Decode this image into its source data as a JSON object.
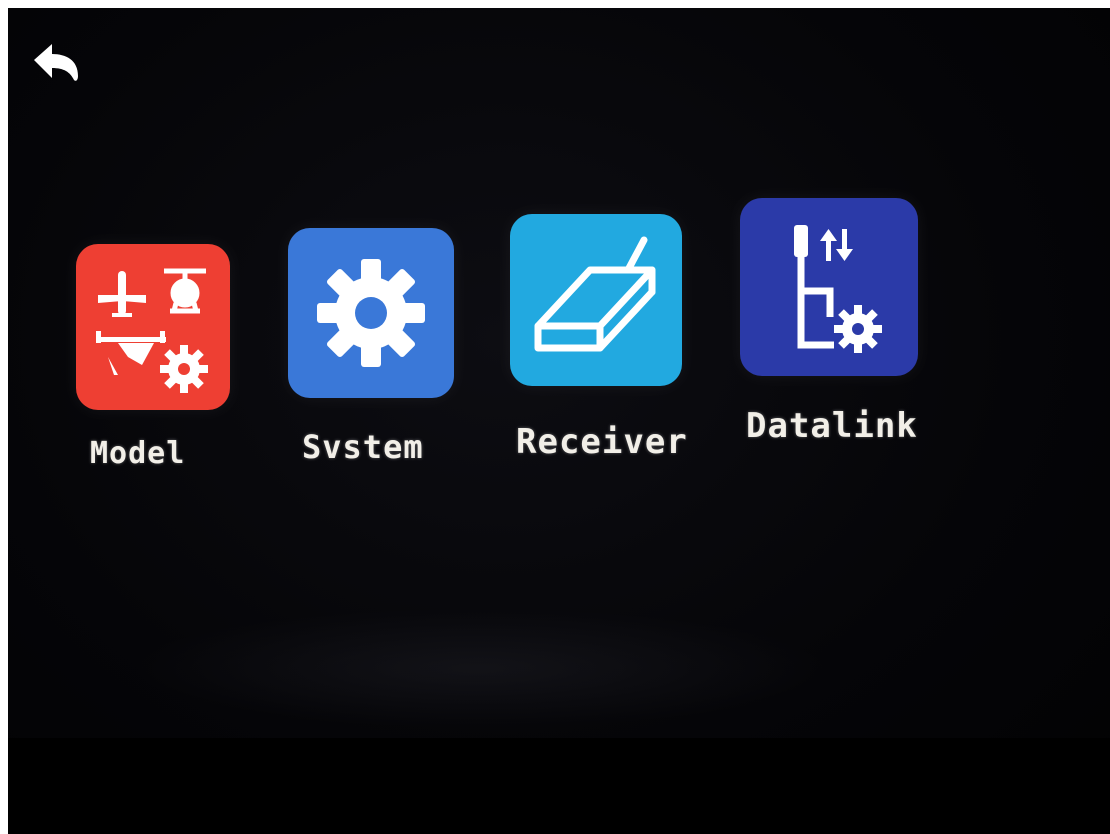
{
  "header": {
    "back_icon": "back-arrow-icon"
  },
  "menu": {
    "items": [
      {
        "label": "Model",
        "icon": "model-icon",
        "color": "#ee3f33"
      },
      {
        "label": "Svstem",
        "icon": "gear-icon",
        "color": "#3a78d8"
      },
      {
        "label": "Receiver",
        "icon": "receiver-icon",
        "color": "#22a9e0"
      },
      {
        "label": "Datalink",
        "icon": "datalink-icon",
        "color": "#2b3aa8"
      }
    ]
  }
}
